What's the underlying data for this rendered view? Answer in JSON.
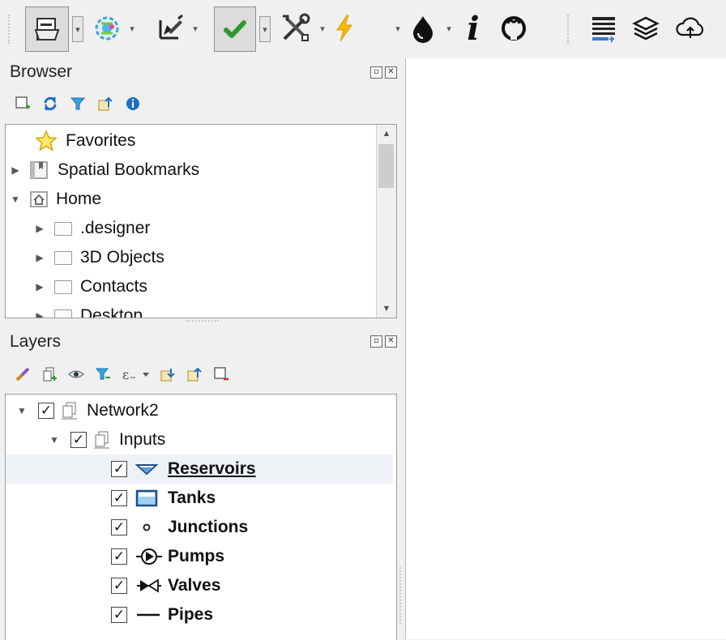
{
  "toolbar": {
    "items": [
      "file-manager-icon",
      "globe-plugin-icon",
      "edit-pencil-icon",
      "validate-check-icon",
      "tools-icon",
      "lightning-icon",
      "water-drop-icon",
      "info-icon",
      "github-icon",
      "attribute-table-icon",
      "layers-stack-icon",
      "cloud-upload-icon"
    ]
  },
  "browser": {
    "title": "Browser",
    "toolbar_icons": [
      "add-icon",
      "refresh-icon",
      "filter-icon",
      "collapse-icon",
      "info-icon"
    ],
    "items": [
      {
        "label": "Favorites",
        "icon": "star-icon"
      },
      {
        "label": "Spatial Bookmarks",
        "icon": "bookmark-icon"
      },
      {
        "label": "Home",
        "icon": "home-icon"
      },
      {
        "label": ".designer",
        "icon": "folder-icon"
      },
      {
        "label": "3D Objects",
        "icon": "folder-icon"
      },
      {
        "label": "Contacts",
        "icon": "folder-icon"
      },
      {
        "label": "Desktop",
        "icon": "folder-icon"
      }
    ]
  },
  "layers": {
    "title": "Layers",
    "toolbar_icons": [
      "style-brush-icon",
      "add-group-icon",
      "visibility-eye-icon",
      "filter-icon",
      "expression-filter-icon",
      "expand-all-icon",
      "collapse-all-icon",
      "remove-layer-icon"
    ],
    "groups": [
      {
        "label": "Network2",
        "checked": true
      },
      {
        "label": "Inputs",
        "checked": true
      }
    ],
    "items": [
      {
        "label": "Reservoirs",
        "icon": "reservoir-triangle-icon",
        "checked": true,
        "selected": true
      },
      {
        "label": "Tanks",
        "icon": "tank-icon",
        "checked": true
      },
      {
        "label": "Junctions",
        "icon": "junction-circle-icon",
        "checked": true
      },
      {
        "label": "Pumps",
        "icon": "pump-icon",
        "checked": true
      },
      {
        "label": "Valves",
        "icon": "valve-icon",
        "checked": true
      },
      {
        "label": "Pipes",
        "icon": "pipe-line-icon",
        "checked": true
      }
    ]
  },
  "colors": {
    "accent_blue": "#1f6fc4",
    "check_green": "#2e9a2e",
    "lightning_yellow": "#f5b800",
    "selected_row": "#eef2f6"
  }
}
